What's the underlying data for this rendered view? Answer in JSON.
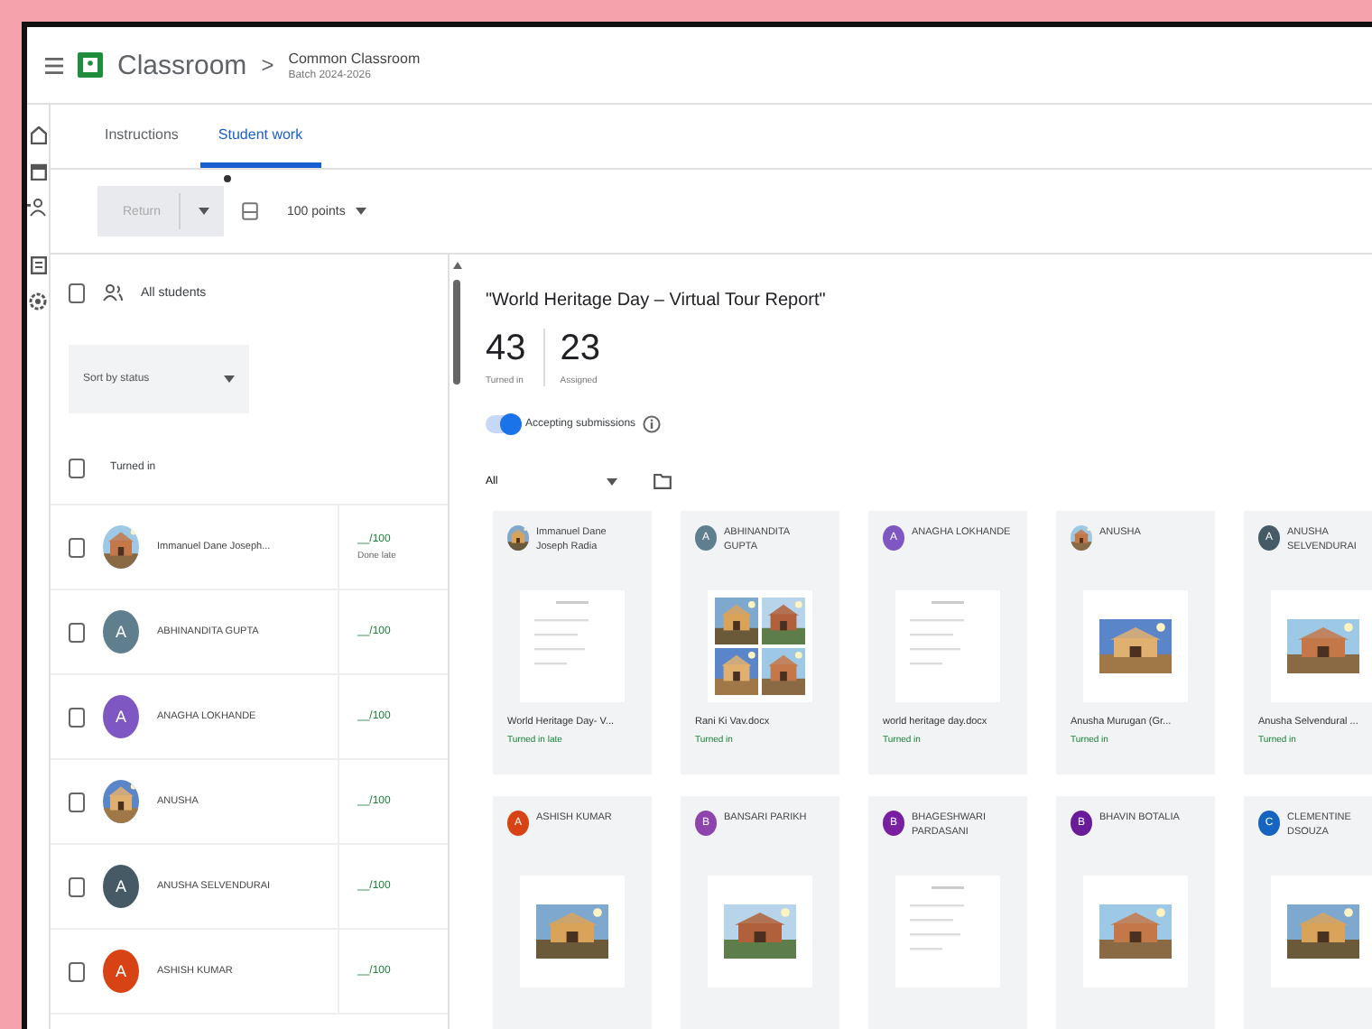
{
  "header": {
    "product": "Classroom",
    "separator": ">",
    "class_name": "Common Classroom",
    "class_section": "Batch 2024-2026"
  },
  "tabs": [
    {
      "label": "Instructions",
      "selected": false
    },
    {
      "label": "Student work",
      "selected": true
    }
  ],
  "toolbar": {
    "return_button": {
      "label": "Return",
      "disabled": true
    },
    "points": "100 points"
  },
  "students_panel": {
    "all_students": {
      "label": "All students",
      "checked": false
    },
    "sort": "Sort by status",
    "group": {
      "label": "Turned in",
      "checked": false
    },
    "students": [
      {
        "name": "Immanuel Dane Joseph...",
        "checked": false,
        "grade": "__/100",
        "note": "Done late"
      },
      {
        "name": "ABHINANDITA GUPTA",
        "checked": false,
        "avatar": {
          "kind": "letter",
          "initial": "A",
          "color": "#5f7f8f"
        },
        "grade": "__/100"
      },
      {
        "name": "ANAGHA LOKHANDE",
        "checked": false,
        "avatar": {
          "kind": "letter",
          "initial": "A",
          "color": "#7e57c2"
        },
        "grade": "__/100"
      },
      {
        "name": "ANUSHA",
        "checked": false,
        "grade": "__/100"
      },
      {
        "name": "ANUSHA SELVENDURAI",
        "checked": false,
        "avatar": {
          "kind": "letter",
          "initial": "A",
          "color": "#455a64"
        },
        "grade": "__/100"
      },
      {
        "name": "ASHISH KUMAR",
        "checked": false,
        "avatar": {
          "kind": "letter",
          "initial": "A",
          "color": "#d84315"
        },
        "grade": "__/100"
      }
    ]
  },
  "assignment": {
    "title": "\"World Heritage Day – Virtual Tour Report\"",
    "stats": [
      {
        "value": "43",
        "label": "Turned in"
      },
      {
        "value": "23",
        "label": "Assigned"
      }
    ],
    "accepting": {
      "label": "Accepting submissions",
      "on": true
    },
    "filter": "All",
    "cards": [
      {
        "name": "Immanuel Dane Joseph Radia",
        "thumb": {
          "kind": "document"
        },
        "file": "World Heritage Day- V...",
        "status": "Turned in late"
      },
      {
        "name": "ABHINANDITA GUPTA",
        "avatar": {
          "kind": "letter",
          "initial": "A",
          "color": "#5f7f8f"
        },
        "thumb": {
          "kind": "grid"
        },
        "file": "Rani Ki Vav.docx",
        "status": "Turned in"
      },
      {
        "name": "ANAGHA LOKHANDE",
        "avatar": {
          "kind": "letter",
          "initial": "A",
          "color": "#7e57c2"
        },
        "thumb": {
          "kind": "document"
        },
        "file": "world heritage day.docx",
        "status": "Turned in"
      },
      {
        "name": "ANUSHA",
        "file": "Anusha Murugan (Gr...",
        "status": "Turned in"
      },
      {
        "name": "ANUSHA SELVENDURAI",
        "avatar": {
          "kind": "letter",
          "initial": "A",
          "color": "#455a64"
        },
        "file": "Anusha Selvendural ...",
        "status": "Turned in"
      },
      {
        "name": "ASHISH KUMAR",
        "avatar": {
          "kind": "letter",
          "initial": "A",
          "color": "#d84315"
        }
      },
      {
        "name": "BANSARI PARIKH",
        "avatar": {
          "kind": "letter",
          "initial": "B",
          "color": "#8e44ad"
        }
      },
      {
        "name": "BHAGESHWARI PARDASANI",
        "avatar": {
          "kind": "letter",
          "initial": "B",
          "color": "#7b1fa2"
        },
        "thumb": {
          "kind": "document"
        }
      },
      {
        "name": "BHAVIN BOTALIA",
        "avatar": {
          "kind": "letter",
          "initial": "B",
          "color": "#6a1b9a"
        }
      },
      {
        "name": "CLEMENTINE DSOUZA",
        "avatar": {
          "kind": "letter",
          "initial": "C",
          "color": "#1565c0"
        }
      }
    ]
  }
}
